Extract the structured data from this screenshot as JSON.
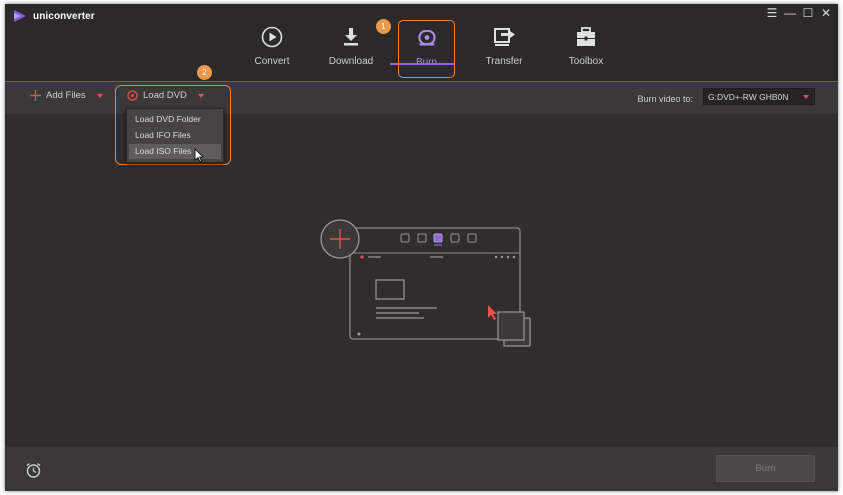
{
  "app": {
    "name": "uniconverter"
  },
  "window_controls": {
    "menu": "☰",
    "minimize": "—",
    "maximize": "☐",
    "close": "✕"
  },
  "nav": {
    "tabs": [
      {
        "label": "Convert",
        "icon": "play-circle-icon"
      },
      {
        "label": "Download",
        "icon": "download-icon"
      },
      {
        "label": "Burn",
        "icon": "disc-icon",
        "active": true
      },
      {
        "label": "Transfer",
        "icon": "transfer-icon"
      },
      {
        "label": "Toolbox",
        "icon": "toolbox-icon"
      }
    ]
  },
  "badges": {
    "one": "1",
    "two": "2"
  },
  "toolbar": {
    "add_files_label": "Add Files",
    "load_dvd_label": "Load DVD",
    "burn_to_label": "Burn video to:",
    "burn_to_value": "G:DVD+-RW GHB0N"
  },
  "dropdown": {
    "items": [
      "Load DVD Folder",
      "Load IFO Files",
      "Load ISO Files"
    ],
    "hovered_index": 2
  },
  "footer": {
    "burn_label": "Burn"
  },
  "colors": {
    "accent_purple": "#8e6bd6",
    "accent_orange": "#e8863a",
    "accent_red": "#e4534a",
    "background": "#2f2d2e"
  }
}
